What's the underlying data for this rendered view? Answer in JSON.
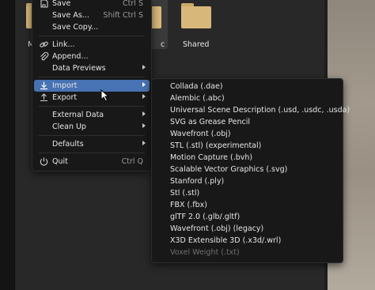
{
  "browser": {
    "folders": [
      {
        "name": "",
        "partial": true
      },
      {
        "name": "",
        "partial": true
      },
      {
        "name": "Shared"
      }
    ],
    "partial_label_left": "M",
    "partial_label_mid": "c"
  },
  "menu": {
    "save": {
      "label": "Save",
      "shortcut": "Ctrl S",
      "icon": "save-icon"
    },
    "save_as": {
      "label": "Save As...",
      "shortcut": "Shift Ctrl S"
    },
    "save_copy": {
      "label": "Save Copy..."
    },
    "link": {
      "label": "Link...",
      "icon": "link-icon"
    },
    "append": {
      "label": "Append...",
      "icon": "append-icon"
    },
    "data_previews": {
      "label": "Data Previews"
    },
    "import": {
      "label": "Import",
      "icon": "import-icon"
    },
    "export": {
      "label": "Export",
      "icon": "export-icon"
    },
    "external_data": {
      "label": "External Data"
    },
    "clean_up": {
      "label": "Clean Up"
    },
    "defaults": {
      "label": "Defaults"
    },
    "quit": {
      "label": "Quit",
      "shortcut": "Ctrl Q",
      "icon": "power-icon"
    }
  },
  "import_submenu": {
    "items": [
      {
        "label": "Collada (.dae)"
      },
      {
        "label": "Alembic (.abc)"
      },
      {
        "label": "Universal Scene Description (.usd, .usdc, .usda)"
      },
      {
        "label": "SVG as Grease Pencil"
      },
      {
        "label": "Wavefront (.obj)"
      },
      {
        "label": "STL (.stl) (experimental)"
      },
      {
        "label": "Motion Capture (.bvh)"
      },
      {
        "label": "Scalable Vector Graphics (.svg)"
      },
      {
        "label": "Stanford (.ply)"
      },
      {
        "label": "Stl (.stl)"
      },
      {
        "label": "FBX (.fbx)"
      },
      {
        "label": "glTF 2.0 (.glb/.gltf)"
      },
      {
        "label": "Wavefront (.obj) (legacy)"
      },
      {
        "label": "X3D Extensible 3D (.x3d/.wrl)"
      },
      {
        "label": "Voxel Weight (.txt)",
        "disabled": true
      }
    ]
  },
  "colors": {
    "menu_bg": "#181818",
    "highlight": "#4772b3",
    "text": "#e6e6e6",
    "shortcut_text": "#9a9a9a",
    "disabled_text": "#6f6f6f",
    "folder": "#d8b87a"
  }
}
